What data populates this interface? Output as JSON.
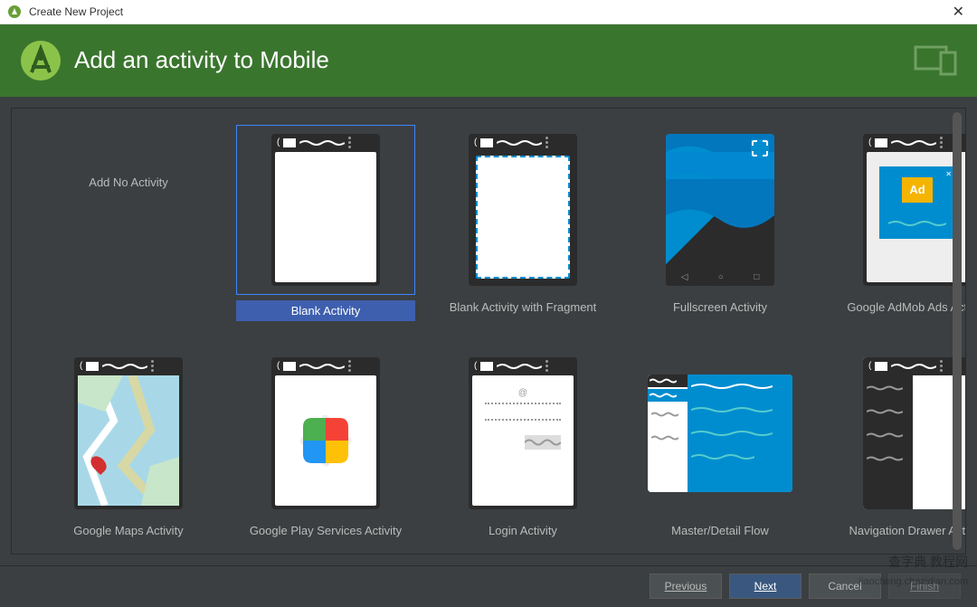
{
  "window": {
    "title": "Create New Project"
  },
  "header": {
    "title": "Add an activity to Mobile"
  },
  "activities": [
    {
      "id": "none",
      "label": "Add No Activity",
      "kind": "none",
      "selected": false
    },
    {
      "id": "blank",
      "label": "Blank Activity",
      "kind": "blank",
      "selected": true
    },
    {
      "id": "fragment",
      "label": "Blank Activity with Fragment",
      "kind": "fragment",
      "selected": false
    },
    {
      "id": "fullscreen",
      "label": "Fullscreen Activity",
      "kind": "fullscreen",
      "selected": false
    },
    {
      "id": "admob",
      "label": "Google AdMob Ads Activity",
      "kind": "admob",
      "selected": false
    },
    {
      "id": "maps",
      "label": "Google Maps Activity",
      "kind": "maps",
      "selected": false
    },
    {
      "id": "play",
      "label": "Google Play Services Activity",
      "kind": "play",
      "selected": false
    },
    {
      "id": "login",
      "label": "Login Activity",
      "kind": "login",
      "selected": false
    },
    {
      "id": "master",
      "label": "Master/Detail Flow",
      "kind": "master",
      "selected": false
    },
    {
      "id": "nav",
      "label": "Navigation Drawer Activity",
      "kind": "nav",
      "selected": false
    }
  ],
  "footer": {
    "previous": "Previous",
    "next": "Next",
    "cancel": "Cancel",
    "finish": "Finish"
  },
  "ad": {
    "label": "Ad"
  },
  "watermark": {
    "line1": "查字典 教程网",
    "line2": "jiaocheng.chazidian.com"
  }
}
